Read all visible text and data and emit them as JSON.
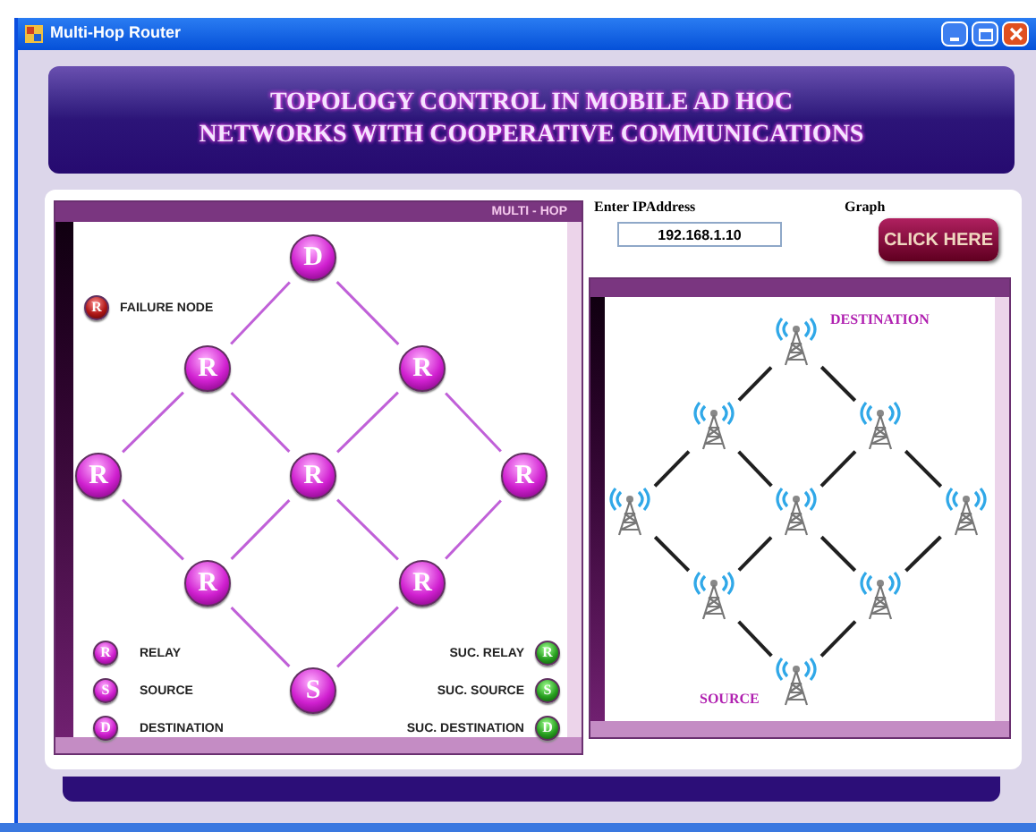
{
  "window": {
    "title": "Multi-Hop Router"
  },
  "banner": {
    "lines": [
      "TOPOLOGY CONTROL IN MOBILE AD HOC",
      "NETWORKS WITH COOPERATIVE COMMUNICATIONS"
    ]
  },
  "multi_hop_panel": {
    "header": "MULTI - HOP",
    "nodes": [
      {
        "label": "D",
        "kind": "normal"
      },
      {
        "label": "R",
        "kind": "normal"
      },
      {
        "label": "R",
        "kind": "normal"
      },
      {
        "label": "R",
        "kind": "normal"
      },
      {
        "label": "R",
        "kind": "normal"
      },
      {
        "label": "R",
        "kind": "normal"
      },
      {
        "label": "R",
        "kind": "normal"
      },
      {
        "label": "R",
        "kind": "normal"
      },
      {
        "label": "S",
        "kind": "normal"
      }
    ],
    "failure_legend": {
      "letter": "R",
      "label": "FAILURE NODE",
      "kind": "failure"
    },
    "legend_left": [
      {
        "letter": "R",
        "label": "RELAY",
        "kind": "normal"
      },
      {
        "letter": "S",
        "label": "SOURCE",
        "kind": "normal"
      },
      {
        "letter": "D",
        "label": "DESTINATION",
        "kind": "normal"
      }
    ],
    "legend_right": [
      {
        "letter": "R",
        "label": "SUC. RELAY",
        "kind": "success"
      },
      {
        "letter": "S",
        "label": "SUC. SOURCE",
        "kind": "success"
      },
      {
        "letter": "D",
        "label": "SUC. DESTINATION",
        "kind": "success"
      }
    ]
  },
  "ip_field": {
    "label": "Enter IPAddress",
    "value": "192.168.1.10"
  },
  "graph": {
    "label": "Graph",
    "button": "CLICK HERE"
  },
  "graph_panel": {
    "destination_label": "DESTINATION",
    "source_label": "SOURCE"
  }
}
